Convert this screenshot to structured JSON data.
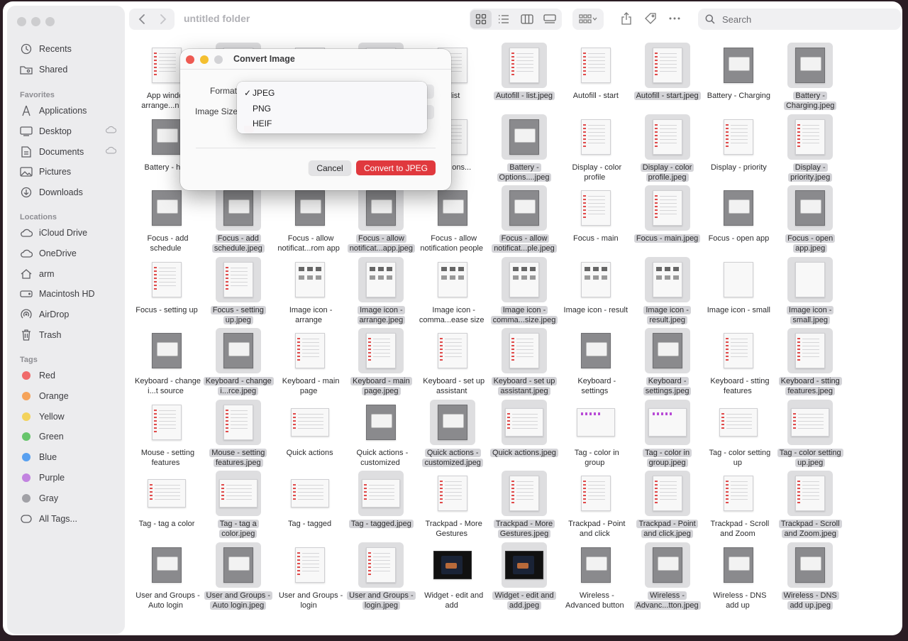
{
  "window": {
    "folder_title": "untitled folder"
  },
  "search": {
    "placeholder": "Search"
  },
  "sidebar": {
    "top_items": [
      {
        "label": "Recents",
        "icon": "clock-icon"
      },
      {
        "label": "Shared",
        "icon": "shared-folder-icon"
      }
    ],
    "favorites_header": "Favorites",
    "favorites": [
      {
        "label": "Applications",
        "icon": "applications-icon"
      },
      {
        "label": "Desktop",
        "icon": "desktop-icon"
      },
      {
        "label": "Documents",
        "icon": "document-icon"
      },
      {
        "label": "Pictures",
        "icon": "photo-icon"
      },
      {
        "label": "Downloads",
        "icon": "download-icon"
      }
    ],
    "locations_header": "Locations",
    "locations": [
      {
        "label": "iCloud Drive",
        "icon": "cloud-icon"
      },
      {
        "label": "OneDrive",
        "icon": "cloud-icon"
      },
      {
        "label": "arm",
        "icon": "home-icon"
      },
      {
        "label": "Macintosh HD",
        "icon": "disk-icon"
      },
      {
        "label": "AirDrop",
        "icon": "airdrop-icon"
      },
      {
        "label": "Trash",
        "icon": "trash-icon"
      }
    ],
    "tags_header": "Tags",
    "tags": [
      {
        "label": "Red",
        "color": "#f06a6a"
      },
      {
        "label": "Orange",
        "color": "#f5a35a"
      },
      {
        "label": "Yellow",
        "color": "#f3d25b"
      },
      {
        "label": "Green",
        "color": "#67c56c"
      },
      {
        "label": "Blue",
        "color": "#58a0f0"
      },
      {
        "label": "Purple",
        "color": "#c283e0"
      },
      {
        "label": "Gray",
        "color": "#a1a1a6"
      }
    ],
    "all_tags": "All Tags..."
  },
  "dialog": {
    "title": "Convert Image",
    "format_label": "Format",
    "image_size_label": "Image Size",
    "format_options": [
      "JPEG",
      "PNG",
      "HEIF"
    ],
    "selected_format": "JPEG",
    "check_mark": "✓",
    "cancel_label": "Cancel",
    "convert_label": "Convert to JPEG",
    "accent_color": "#e0393e"
  },
  "files": [
    {
      "name": "App window arrange...n bu",
      "sel": false,
      "kind": "doc"
    },
    {
      "name": "",
      "sel": true,
      "kind": "doc"
    },
    {
      "name": "",
      "sel": false,
      "kind": "doc"
    },
    {
      "name": "",
      "sel": true,
      "kind": "doc"
    },
    {
      "name": "- list",
      "sel": false,
      "kind": "doc"
    },
    {
      "name": "Autofill - list.jpeg",
      "sel": true,
      "kind": "doc"
    },
    {
      "name": "Autofill - start",
      "sel": false,
      "kind": "doc"
    },
    {
      "name": "Autofill - start.jpeg",
      "sel": true,
      "kind": "doc"
    },
    {
      "name": "Battery - Charging",
      "sel": false,
      "kind": "dark"
    },
    {
      "name": "Battery - Charging.jpeg",
      "sel": true,
      "kind": "dark"
    },
    {
      "name": "Battery - hea",
      "sel": false,
      "kind": "dark"
    },
    {
      "name": "",
      "sel": true,
      "kind": "dark"
    },
    {
      "name": "",
      "sel": false,
      "kind": "dark"
    },
    {
      "name": "",
      "sel": true,
      "kind": "dark"
    },
    {
      "name": "ery - ons...",
      "sel": false,
      "kind": "doc"
    },
    {
      "name": "Battery - Options....jpeg",
      "sel": true,
      "kind": "dark"
    },
    {
      "name": "Display - color profile",
      "sel": false,
      "kind": "doc"
    },
    {
      "name": "Display - color profile.jpeg",
      "sel": true,
      "kind": "doc"
    },
    {
      "name": "Display - priority",
      "sel": false,
      "kind": "doc"
    },
    {
      "name": "Display - priority.jpeg",
      "sel": true,
      "kind": "doc"
    },
    {
      "name": "Focus - add schedule",
      "sel": false,
      "kind": "dark"
    },
    {
      "name": "Focus - add schedule.jpeg",
      "sel": true,
      "kind": "dark"
    },
    {
      "name": "Focus - allow notificat...rom app",
      "sel": false,
      "kind": "dark"
    },
    {
      "name": "Focus - allow notificat...app.jpeg",
      "sel": true,
      "kind": "dark"
    },
    {
      "name": "Focus - allow notification people",
      "sel": false,
      "kind": "dark"
    },
    {
      "name": "Focus - allow notificat...ple.jpeg",
      "sel": true,
      "kind": "dark"
    },
    {
      "name": "Focus - main",
      "sel": false,
      "kind": "doc"
    },
    {
      "name": "Focus - main.jpeg",
      "sel": true,
      "kind": "doc"
    },
    {
      "name": "Focus - open app",
      "sel": false,
      "kind": "dark"
    },
    {
      "name": "Focus - open app.jpeg",
      "sel": true,
      "kind": "dark"
    },
    {
      "name": "Focus - setting up",
      "sel": false,
      "kind": "doc"
    },
    {
      "name": "Focus - setting up.jpeg",
      "sel": true,
      "kind": "doc"
    },
    {
      "name": "Image icon - arrange",
      "sel": false,
      "kind": "grid"
    },
    {
      "name": "Image icon - arrange.jpeg",
      "sel": true,
      "kind": "grid"
    },
    {
      "name": "Image icon - comma...ease size",
      "sel": false,
      "kind": "grid"
    },
    {
      "name": "Image icon - comma...size.jpeg",
      "sel": true,
      "kind": "grid"
    },
    {
      "name": "Image icon - result",
      "sel": false,
      "kind": "grid"
    },
    {
      "name": "Image icon - result.jpeg",
      "sel": true,
      "kind": "grid"
    },
    {
      "name": "Image icon - small",
      "sel": false,
      "kind": "plain"
    },
    {
      "name": "Image icon - small.jpeg",
      "sel": true,
      "kind": "plain"
    },
    {
      "name": "Keyboard - change i...t source",
      "sel": false,
      "kind": "dark"
    },
    {
      "name": "Keyboard - change i...rce.jpeg",
      "sel": true,
      "kind": "dark"
    },
    {
      "name": "Keyboard - main page",
      "sel": false,
      "kind": "doc"
    },
    {
      "name": "Keyboard - main page.jpeg",
      "sel": true,
      "kind": "doc"
    },
    {
      "name": "Keyboard - set up assistant",
      "sel": false,
      "kind": "doc"
    },
    {
      "name": "Keyboard - set up assistant.jpeg",
      "sel": true,
      "kind": "doc"
    },
    {
      "name": "Keyboard - settings",
      "sel": false,
      "kind": "dark"
    },
    {
      "name": "Keyboard - settings.jpeg",
      "sel": true,
      "kind": "dark"
    },
    {
      "name": "Keyboard - stting features",
      "sel": false,
      "kind": "doc"
    },
    {
      "name": "Keyboard - stting features.jpeg",
      "sel": true,
      "kind": "doc"
    },
    {
      "name": "Mouse - setting features",
      "sel": false,
      "kind": "doc"
    },
    {
      "name": "Mouse - setting features.jpeg",
      "sel": true,
      "kind": "doc"
    },
    {
      "name": "Quick actions",
      "sel": false,
      "kind": "wide"
    },
    {
      "name": "Quick actions - customized",
      "sel": false,
      "kind": "dark"
    },
    {
      "name": "Quick actions - customized.jpeg",
      "sel": true,
      "kind": "dark"
    },
    {
      "name": "Quick actions.jpeg",
      "sel": true,
      "kind": "wide"
    },
    {
      "name": "Tag - color in group",
      "sel": false,
      "kind": "dots"
    },
    {
      "name": "Tag - color in group.jpeg",
      "sel": true,
      "kind": "dots"
    },
    {
      "name": "Tag - color setting up",
      "sel": false,
      "kind": "wide"
    },
    {
      "name": "Tag - color setting up.jpeg",
      "sel": true,
      "kind": "wide"
    },
    {
      "name": "Tag - tag a color",
      "sel": false,
      "kind": "wide"
    },
    {
      "name": "Tag - tag a color.jpeg",
      "sel": true,
      "kind": "wide"
    },
    {
      "name": "Tag - tagged",
      "sel": false,
      "kind": "wide"
    },
    {
      "name": "Tag - tagged.jpeg",
      "sel": true,
      "kind": "wide"
    },
    {
      "name": "Trackpad - More Gestures",
      "sel": false,
      "kind": "doc"
    },
    {
      "name": "Trackpad - More Gestures.jpeg",
      "sel": true,
      "kind": "doc"
    },
    {
      "name": "Trackpad - Point and click",
      "sel": false,
      "kind": "doc"
    },
    {
      "name": "Trackpad - Point and click.jpeg",
      "sel": true,
      "kind": "doc"
    },
    {
      "name": "Trackpad - Scroll and Zoom",
      "sel": false,
      "kind": "doc"
    },
    {
      "name": "Trackpad - Scroll and Zoom.jpeg",
      "sel": true,
      "kind": "doc"
    },
    {
      "name": "User and Groups - Auto login",
      "sel": false,
      "kind": "dark"
    },
    {
      "name": "User and Groups - Auto login.jpeg",
      "sel": true,
      "kind": "dark"
    },
    {
      "name": "User and Groups - login",
      "sel": false,
      "kind": "doc"
    },
    {
      "name": "User and Groups - login.jpeg",
      "sel": true,
      "kind": "doc"
    },
    {
      "name": "Widget - edit and add",
      "sel": false,
      "kind": "black"
    },
    {
      "name": "Widget - edit and add.jpeg",
      "sel": true,
      "kind": "black"
    },
    {
      "name": "Wireless - Advanced button",
      "sel": false,
      "kind": "dark"
    },
    {
      "name": "Wireless - Advanc...tton.jpeg",
      "sel": true,
      "kind": "dark"
    },
    {
      "name": "Wireless - DNS add up",
      "sel": false,
      "kind": "dark"
    },
    {
      "name": "Wireless - DNS add up.jpeg",
      "sel": true,
      "kind": "dark"
    }
  ]
}
